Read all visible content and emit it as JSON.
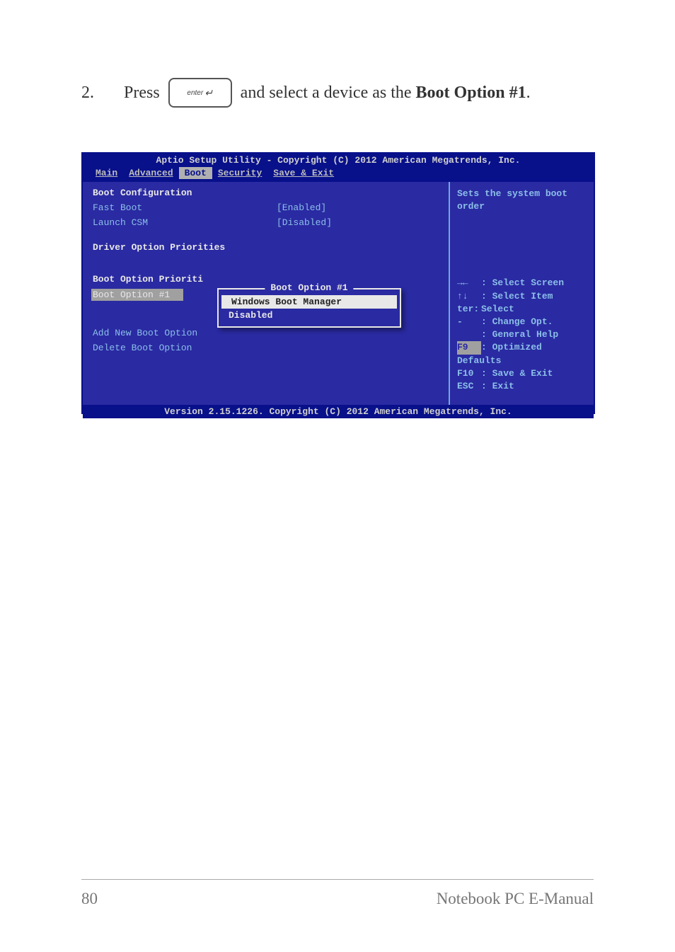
{
  "instruction": {
    "step": "2.",
    "before_key": "Press",
    "after_key": " and select a device as the ",
    "bold_part": "Boot Option #1",
    "after_bold": ".",
    "key_label": "enter"
  },
  "bios": {
    "header": "Aptio Setup Utility - Copyright (C) 2012 American Megatrends, Inc.",
    "menubar": {
      "items": [
        "Main",
        "Advanced",
        "Boot",
        "Security",
        "Save & Exit"
      ],
      "active_index": 2
    },
    "left": {
      "section1": "Boot Configuration",
      "fast_boot_label": "Fast Boot",
      "fast_boot_value": "[Enabled]",
      "launch_csm_label": "Launch CSM",
      "launch_csm_value": "[Disabled]",
      "section2": "Driver Option Priorities",
      "section3_partial": "Boot Option Prioriti",
      "boot_option1_label": "Boot Option #1",
      "add_new": "Add New Boot Option",
      "delete": "Delete Boot Option"
    },
    "right": {
      "help_title": "Sets the system boot order",
      "nav": [
        {
          "key": "→←",
          "text": ": Select Screen"
        },
        {
          "key": "↑↓",
          "text": ": Select Item"
        },
        {
          "key": "ter:",
          "text": "Select",
          "partial": true
        },
        {
          "key": "-",
          "text": ": Change Opt."
        },
        {
          "key": "",
          "text": ": General Help"
        },
        {
          "key": "F9",
          "text": ": Optimized Defaults",
          "hl": true
        },
        {
          "key": "F10",
          "text": ": Save & Exit"
        },
        {
          "key": "ESC",
          "text": ": Exit"
        }
      ]
    },
    "popup": {
      "title": "Boot Option #1",
      "items": [
        "Windows Boot Manager",
        "Disabled"
      ],
      "selected_index": 0
    },
    "footer": "Version 2.15.1226. Copyright (C) 2012 American Megatrends, Inc."
  },
  "page": {
    "number": "80",
    "manual": "Notebook PC E-Manual"
  }
}
